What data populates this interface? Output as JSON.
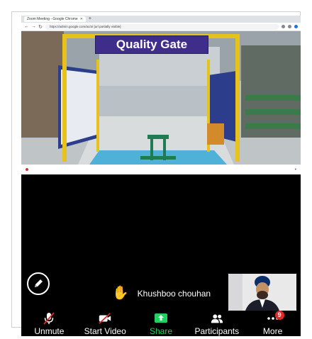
{
  "browser": {
    "tab_title": "Zoom Meeting - Google Chrome",
    "url": "https://admin.google.com/ac/a/ [url partially visible]"
  },
  "video": {
    "sign_text": "Quality Gate"
  },
  "meeting": {
    "raised_hand_name": "Khushboo chouhan"
  },
  "controls": {
    "unmute": "Unmute",
    "start_video": "Start Video",
    "share": "Share",
    "participants": "Participants",
    "more": "More",
    "more_badge": "9"
  },
  "colors": {
    "background": "#000000",
    "share_green": "#23d160",
    "badge_red": "#e02828",
    "sign_purple": "#3f2d8c",
    "hand_yellow": "#f5b800"
  }
}
